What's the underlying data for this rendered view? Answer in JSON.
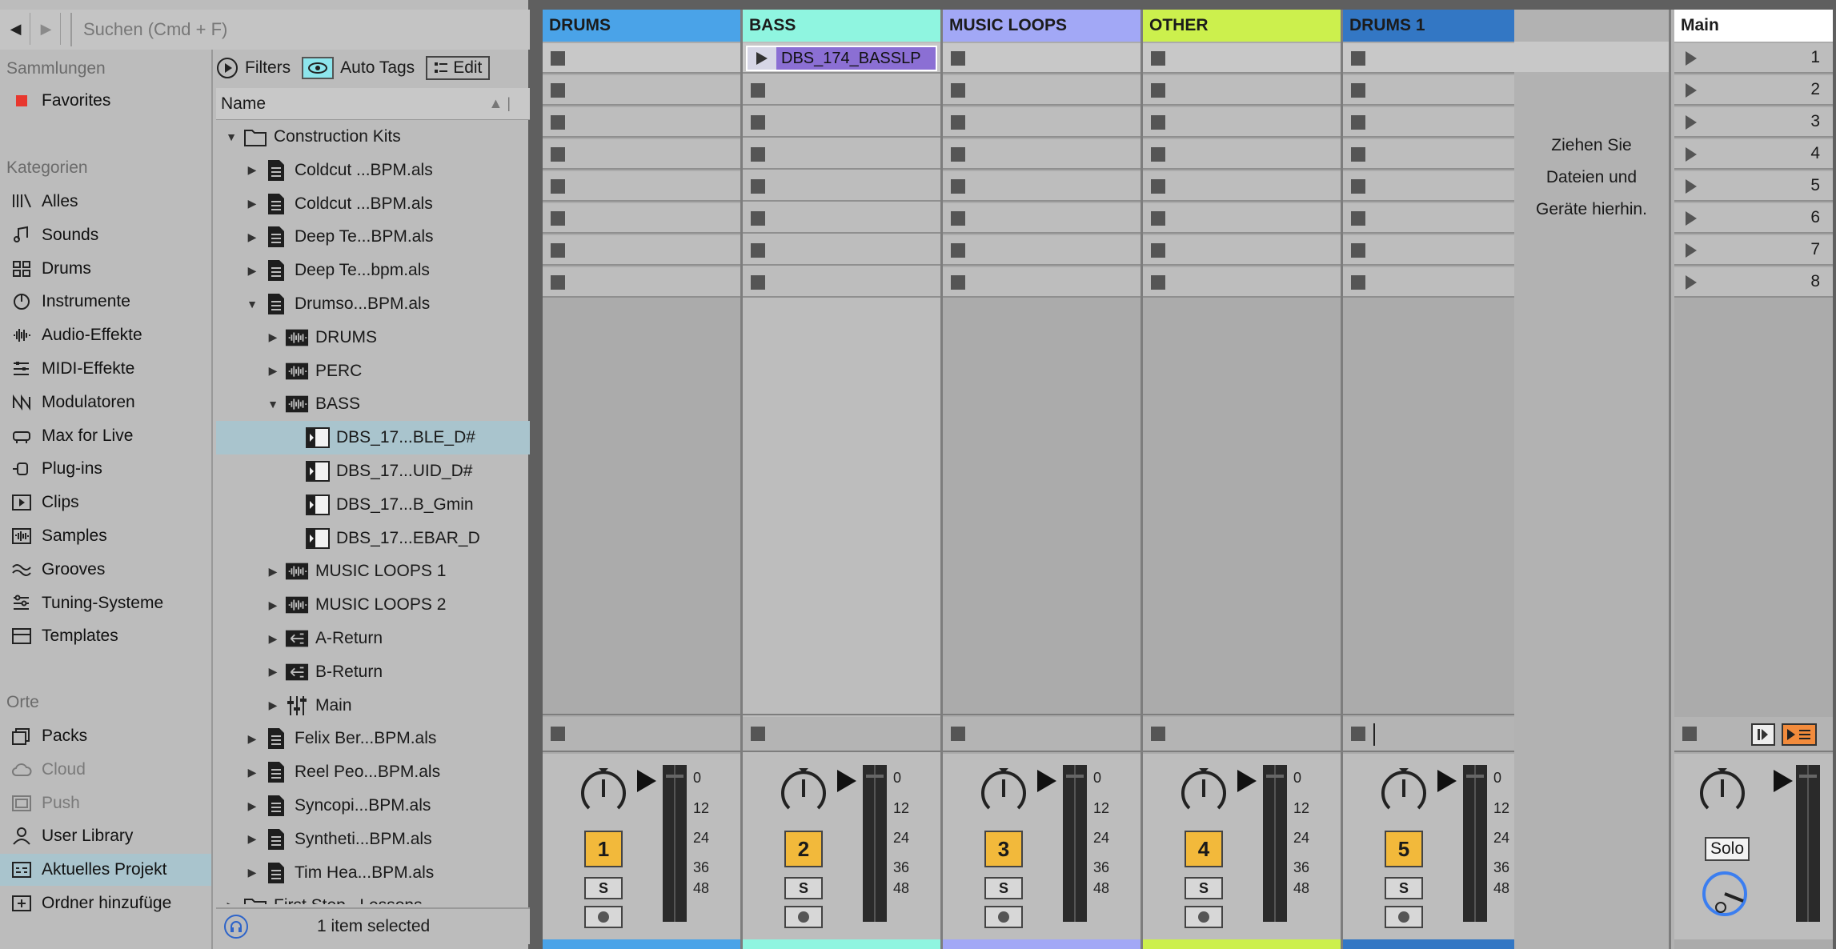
{
  "browser": {
    "search_placeholder": "Suchen (Cmd + F)",
    "sections": {
      "collections": "Sammlungen",
      "categories": "Kategorien",
      "places": "Orte"
    },
    "collections": [
      {
        "label": "Favorites",
        "color": "#e8372e"
      }
    ],
    "categories": [
      {
        "label": "Alles",
        "icon": "library-icon"
      },
      {
        "label": "Sounds",
        "icon": "note-icon"
      },
      {
        "label": "Drums",
        "icon": "grid-icon"
      },
      {
        "label": "Instrumente",
        "icon": "clock-icon"
      },
      {
        "label": "Audio-Effekte",
        "icon": "waveform-icon"
      },
      {
        "label": "MIDI-Effekte",
        "icon": "midi-icon"
      },
      {
        "label": "Modulatoren",
        "icon": "modulator-icon"
      },
      {
        "label": "Max for Live",
        "icon": "max-icon"
      },
      {
        "label": "Plug-ins",
        "icon": "plug-icon"
      },
      {
        "label": "Clips",
        "icon": "clip-icon"
      },
      {
        "label": "Samples",
        "icon": "sample-icon"
      },
      {
        "label": "Grooves",
        "icon": "wave-icon"
      },
      {
        "label": "Tuning-Systeme",
        "icon": "tuning-icon"
      },
      {
        "label": "Templates",
        "icon": "template-icon"
      }
    ],
    "places": [
      {
        "label": "Packs",
        "icon": "packs-icon"
      },
      {
        "label": "Cloud",
        "icon": "cloud-icon"
      },
      {
        "label": "Push",
        "icon": "push-icon"
      },
      {
        "label": "User Library",
        "icon": "user-icon"
      },
      {
        "label": "Aktuelles Projekt",
        "icon": "project-icon"
      },
      {
        "label": "Ordner hinzufüge",
        "icon": "add-folder-icon"
      }
    ],
    "filters_label": "Filters",
    "autotags_label": "Auto Tags",
    "edit_label": "Edit",
    "column_name": "Name",
    "status": "1 item selected",
    "tree": [
      {
        "label": "Construction Kits",
        "depth": 0,
        "expander": "open",
        "icon": "folder"
      },
      {
        "label": "Coldcut ...BPM.als",
        "depth": 1,
        "expander": "closed",
        "icon": "set"
      },
      {
        "label": "Coldcut ...BPM.als",
        "depth": 1,
        "expander": "closed",
        "icon": "set"
      },
      {
        "label": "Deep Te...BPM.als",
        "depth": 1,
        "expander": "closed",
        "icon": "set"
      },
      {
        "label": "Deep Te...bpm.als",
        "depth": 1,
        "expander": "closed",
        "icon": "set"
      },
      {
        "label": "Drumso...BPM.als",
        "depth": 1,
        "expander": "open",
        "icon": "set"
      },
      {
        "label": "DRUMS",
        "depth": 2,
        "expander": "closed",
        "icon": "track"
      },
      {
        "label": "PERC",
        "depth": 2,
        "expander": "closed",
        "icon": "track"
      },
      {
        "label": "BASS",
        "depth": 2,
        "expander": "open",
        "icon": "track"
      },
      {
        "label": "DBS_17...BLE_D#",
        "depth": 3,
        "expander": "none",
        "icon": "clip",
        "selected": true
      },
      {
        "label": "DBS_17...UID_D#",
        "depth": 3,
        "expander": "none",
        "icon": "clip"
      },
      {
        "label": "DBS_17...B_Gmin",
        "depth": 3,
        "expander": "none",
        "icon": "clip"
      },
      {
        "label": "DBS_17...EBAR_D",
        "depth": 3,
        "expander": "none",
        "icon": "clip"
      },
      {
        "label": "MUSIC LOOPS 1",
        "depth": 2,
        "expander": "closed",
        "icon": "track"
      },
      {
        "label": "MUSIC LOOPS 2",
        "depth": 2,
        "expander": "closed",
        "icon": "track"
      },
      {
        "label": "A-Return",
        "depth": 2,
        "expander": "closed",
        "icon": "return"
      },
      {
        "label": "B-Return",
        "depth": 2,
        "expander": "closed",
        "icon": "return"
      },
      {
        "label": "Main",
        "depth": 2,
        "expander": "closed",
        "icon": "mixer"
      },
      {
        "label": "Felix Ber...BPM.als",
        "depth": 1,
        "expander": "closed",
        "icon": "set"
      },
      {
        "label": "Reel Peo...BPM.als",
        "depth": 1,
        "expander": "closed",
        "icon": "set"
      },
      {
        "label": "Syncopi...BPM.als",
        "depth": 1,
        "expander": "closed",
        "icon": "set"
      },
      {
        "label": "Syntheti...BPM.als",
        "depth": 1,
        "expander": "closed",
        "icon": "set"
      },
      {
        "label": "Tim Hea...BPM.als",
        "depth": 1,
        "expander": "closed",
        "icon": "set"
      },
      {
        "label": "First Step...Lessons",
        "depth": 0,
        "expander": "closed",
        "icon": "folder"
      }
    ]
  },
  "session": {
    "tracks": [
      {
        "name": "DRUMS",
        "color": "#4aa3e8",
        "number": "1",
        "clip": null
      },
      {
        "name": "BASS",
        "color": "#8ff5e0",
        "number": "2",
        "clip": "DBS_174_BASSLP"
      },
      {
        "name": "MUSIC LOOPS",
        "color": "#a2a8f6",
        "number": "3",
        "clip": null
      },
      {
        "name": "OTHER",
        "color": "#ccf04d",
        "number": "4",
        "clip": null
      },
      {
        "name": "DRUMS 1",
        "color": "#3377c4",
        "number": "5",
        "clip": null
      }
    ],
    "clip_color": "#8b6fd4",
    "meter_scale": [
      "0",
      "12",
      "24",
      "36",
      "48"
    ],
    "solo_label": "S",
    "drop_hint": [
      "Ziehen Sie",
      "Dateien und",
      "Geräte hierhin."
    ],
    "main": {
      "name": "Main",
      "scenes": [
        "1",
        "2",
        "3",
        "4",
        "5",
        "6",
        "7",
        "8"
      ],
      "solo_label": "Solo"
    }
  }
}
